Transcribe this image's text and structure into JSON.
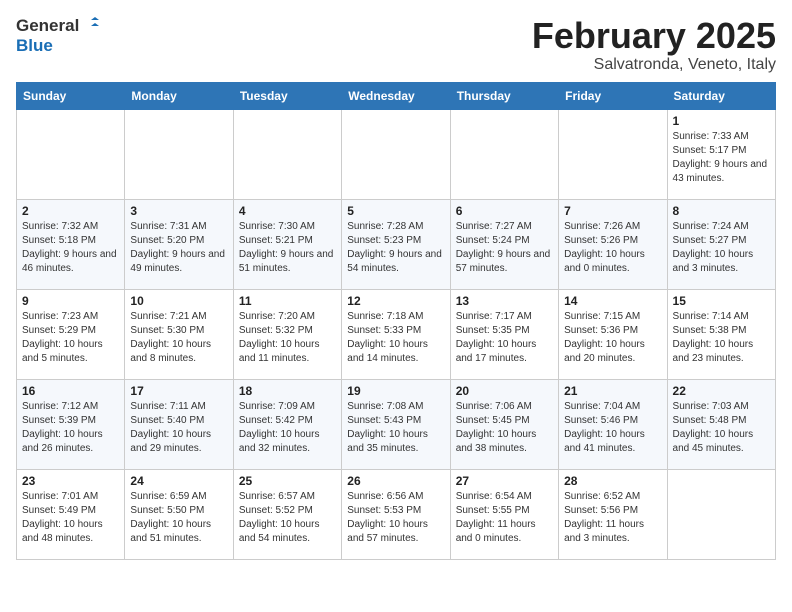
{
  "header": {
    "logo_general": "General",
    "logo_blue": "Blue",
    "month_title": "February 2025",
    "subtitle": "Salvatronda, Veneto, Italy"
  },
  "days_of_week": [
    "Sunday",
    "Monday",
    "Tuesday",
    "Wednesday",
    "Thursday",
    "Friday",
    "Saturday"
  ],
  "weeks": [
    [
      {
        "day": "",
        "info": ""
      },
      {
        "day": "",
        "info": ""
      },
      {
        "day": "",
        "info": ""
      },
      {
        "day": "",
        "info": ""
      },
      {
        "day": "",
        "info": ""
      },
      {
        "day": "",
        "info": ""
      },
      {
        "day": "1",
        "info": "Sunrise: 7:33 AM\nSunset: 5:17 PM\nDaylight: 9 hours and 43 minutes."
      }
    ],
    [
      {
        "day": "2",
        "info": "Sunrise: 7:32 AM\nSunset: 5:18 PM\nDaylight: 9 hours and 46 minutes."
      },
      {
        "day": "3",
        "info": "Sunrise: 7:31 AM\nSunset: 5:20 PM\nDaylight: 9 hours and 49 minutes."
      },
      {
        "day": "4",
        "info": "Sunrise: 7:30 AM\nSunset: 5:21 PM\nDaylight: 9 hours and 51 minutes."
      },
      {
        "day": "5",
        "info": "Sunrise: 7:28 AM\nSunset: 5:23 PM\nDaylight: 9 hours and 54 minutes."
      },
      {
        "day": "6",
        "info": "Sunrise: 7:27 AM\nSunset: 5:24 PM\nDaylight: 9 hours and 57 minutes."
      },
      {
        "day": "7",
        "info": "Sunrise: 7:26 AM\nSunset: 5:26 PM\nDaylight: 10 hours and 0 minutes."
      },
      {
        "day": "8",
        "info": "Sunrise: 7:24 AM\nSunset: 5:27 PM\nDaylight: 10 hours and 3 minutes."
      }
    ],
    [
      {
        "day": "9",
        "info": "Sunrise: 7:23 AM\nSunset: 5:29 PM\nDaylight: 10 hours and 5 minutes."
      },
      {
        "day": "10",
        "info": "Sunrise: 7:21 AM\nSunset: 5:30 PM\nDaylight: 10 hours and 8 minutes."
      },
      {
        "day": "11",
        "info": "Sunrise: 7:20 AM\nSunset: 5:32 PM\nDaylight: 10 hours and 11 minutes."
      },
      {
        "day": "12",
        "info": "Sunrise: 7:18 AM\nSunset: 5:33 PM\nDaylight: 10 hours and 14 minutes."
      },
      {
        "day": "13",
        "info": "Sunrise: 7:17 AM\nSunset: 5:35 PM\nDaylight: 10 hours and 17 minutes."
      },
      {
        "day": "14",
        "info": "Sunrise: 7:15 AM\nSunset: 5:36 PM\nDaylight: 10 hours and 20 minutes."
      },
      {
        "day": "15",
        "info": "Sunrise: 7:14 AM\nSunset: 5:38 PM\nDaylight: 10 hours and 23 minutes."
      }
    ],
    [
      {
        "day": "16",
        "info": "Sunrise: 7:12 AM\nSunset: 5:39 PM\nDaylight: 10 hours and 26 minutes."
      },
      {
        "day": "17",
        "info": "Sunrise: 7:11 AM\nSunset: 5:40 PM\nDaylight: 10 hours and 29 minutes."
      },
      {
        "day": "18",
        "info": "Sunrise: 7:09 AM\nSunset: 5:42 PM\nDaylight: 10 hours and 32 minutes."
      },
      {
        "day": "19",
        "info": "Sunrise: 7:08 AM\nSunset: 5:43 PM\nDaylight: 10 hours and 35 minutes."
      },
      {
        "day": "20",
        "info": "Sunrise: 7:06 AM\nSunset: 5:45 PM\nDaylight: 10 hours and 38 minutes."
      },
      {
        "day": "21",
        "info": "Sunrise: 7:04 AM\nSunset: 5:46 PM\nDaylight: 10 hours and 41 minutes."
      },
      {
        "day": "22",
        "info": "Sunrise: 7:03 AM\nSunset: 5:48 PM\nDaylight: 10 hours and 45 minutes."
      }
    ],
    [
      {
        "day": "23",
        "info": "Sunrise: 7:01 AM\nSunset: 5:49 PM\nDaylight: 10 hours and 48 minutes."
      },
      {
        "day": "24",
        "info": "Sunrise: 6:59 AM\nSunset: 5:50 PM\nDaylight: 10 hours and 51 minutes."
      },
      {
        "day": "25",
        "info": "Sunrise: 6:57 AM\nSunset: 5:52 PM\nDaylight: 10 hours and 54 minutes."
      },
      {
        "day": "26",
        "info": "Sunrise: 6:56 AM\nSunset: 5:53 PM\nDaylight: 10 hours and 57 minutes."
      },
      {
        "day": "27",
        "info": "Sunrise: 6:54 AM\nSunset: 5:55 PM\nDaylight: 11 hours and 0 minutes."
      },
      {
        "day": "28",
        "info": "Sunrise: 6:52 AM\nSunset: 5:56 PM\nDaylight: 11 hours and 3 minutes."
      },
      {
        "day": "",
        "info": ""
      }
    ]
  ]
}
